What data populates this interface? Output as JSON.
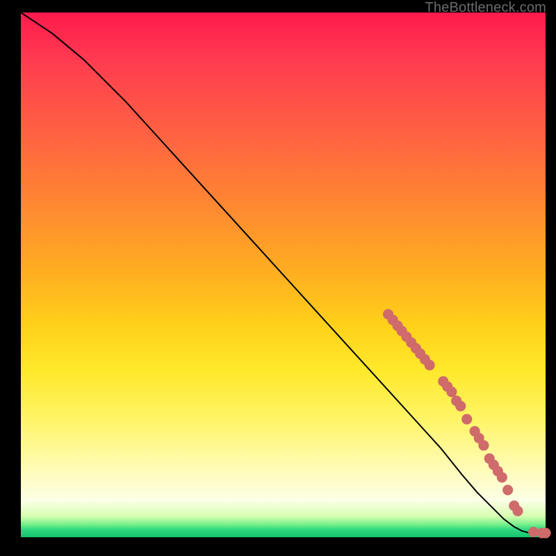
{
  "watermark": "TheBottleneck.com",
  "chart_data": {
    "type": "line",
    "title": "",
    "xlabel": "",
    "ylabel": "",
    "xlim": [
      0,
      100
    ],
    "ylim": [
      0,
      100
    ],
    "grid": false,
    "series": [
      {
        "name": "bottleneck-curve",
        "color": "#000000",
        "x": [
          0,
          3,
          6,
          9,
          12,
          15,
          20,
          25,
          30,
          35,
          40,
          45,
          50,
          55,
          60,
          65,
          70,
          75,
          80,
          84,
          87,
          90,
          92,
          94,
          95.5,
          97,
          98.5,
          100
        ],
        "values": [
          100,
          98,
          96,
          93.5,
          91,
          88,
          83,
          77.5,
          72,
          66.5,
          61,
          55.5,
          50,
          44.5,
          39,
          33.5,
          28,
          22.5,
          17,
          12,
          8.5,
          5.5,
          3.5,
          2,
          1.2,
          0.8,
          0.6,
          0.6
        ]
      }
    ],
    "markers": {
      "name": "bottleneck-points",
      "color": "#cf6b6b",
      "radius_frac": 0.01,
      "points": [
        {
          "x": 70.0,
          "y": 42.5
        },
        {
          "x": 70.9,
          "y": 41.4
        },
        {
          "x": 71.8,
          "y": 40.3
        },
        {
          "x": 72.6,
          "y": 39.3
        },
        {
          "x": 73.5,
          "y": 38.2
        },
        {
          "x": 74.4,
          "y": 37.1
        },
        {
          "x": 75.3,
          "y": 36.0
        },
        {
          "x": 76.1,
          "y": 35.0
        },
        {
          "x": 77.0,
          "y": 33.9
        },
        {
          "x": 77.9,
          "y": 32.8
        },
        {
          "x": 80.5,
          "y": 29.7
        },
        {
          "x": 81.3,
          "y": 28.7
        },
        {
          "x": 82.1,
          "y": 27.7
        },
        {
          "x": 83.0,
          "y": 26.0
        },
        {
          "x": 83.8,
          "y": 25.0
        },
        {
          "x": 85.0,
          "y": 22.5
        },
        {
          "x": 86.5,
          "y": 20.2
        },
        {
          "x": 87.3,
          "y": 18.9
        },
        {
          "x": 88.2,
          "y": 17.5
        },
        {
          "x": 89.3,
          "y": 15.0
        },
        {
          "x": 90.1,
          "y": 13.8
        },
        {
          "x": 90.9,
          "y": 12.6
        },
        {
          "x": 91.7,
          "y": 11.4
        },
        {
          "x": 92.8,
          "y": 9.0
        },
        {
          "x": 94.0,
          "y": 6.0
        },
        {
          "x": 94.7,
          "y": 5.0
        },
        {
          "x": 97.7,
          "y": 1.0
        },
        {
          "x": 99.3,
          "y": 0.8
        },
        {
          "x": 100.0,
          "y": 0.8
        }
      ]
    }
  }
}
